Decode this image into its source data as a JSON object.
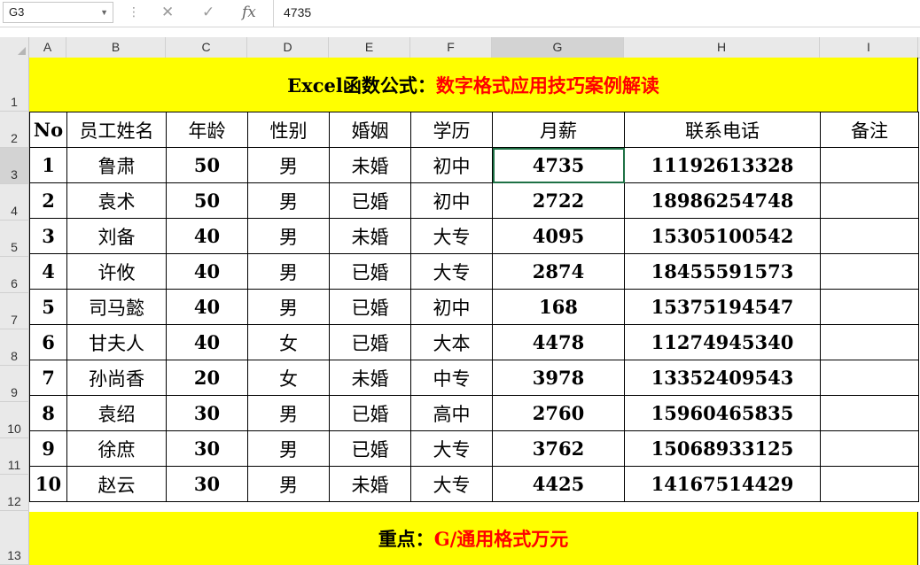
{
  "formula_bar": {
    "name_box": "G3",
    "dots": "⋮",
    "cancel_icon": "✕",
    "enter_icon": "✓",
    "fx_label": "fx",
    "content": "4735"
  },
  "columns": [
    "A",
    "B",
    "C",
    "D",
    "E",
    "F",
    "G",
    "H",
    "I"
  ],
  "rows": [
    "1",
    "2",
    "3",
    "4",
    "5",
    "6",
    "7",
    "8",
    "9",
    "10",
    "11",
    "12",
    "13"
  ],
  "title": {
    "prefix": "Excel函数公式：",
    "highlight": "数字格式应用技巧案例解读"
  },
  "table": {
    "headers": [
      "No",
      "员工姓名",
      "年龄",
      "性别",
      "婚姻",
      "学历",
      "月薪",
      "联系电话",
      "备注"
    ],
    "data": [
      [
        "1",
        "鲁肃",
        "50",
        "男",
        "未婚",
        "初中",
        "4735",
        "11192613328",
        ""
      ],
      [
        "2",
        "袁术",
        "50",
        "男",
        "已婚",
        "初中",
        "2722",
        "18986254748",
        ""
      ],
      [
        "3",
        "刘备",
        "40",
        "男",
        "未婚",
        "大专",
        "4095",
        "15305100542",
        ""
      ],
      [
        "4",
        "许攸",
        "40",
        "男",
        "已婚",
        "大专",
        "2874",
        "18455591573",
        ""
      ],
      [
        "5",
        "司马懿",
        "40",
        "男",
        "已婚",
        "初中",
        "168",
        "15375194547",
        ""
      ],
      [
        "6",
        "甘夫人",
        "40",
        "女",
        "已婚",
        "大本",
        "4478",
        "11274945340",
        ""
      ],
      [
        "7",
        "孙尚香",
        "20",
        "女",
        "未婚",
        "中专",
        "3978",
        "13352409543",
        ""
      ],
      [
        "8",
        "袁绍",
        "30",
        "男",
        "已婚",
        "高中",
        "2760",
        "15960465835",
        ""
      ],
      [
        "9",
        "徐庶",
        "30",
        "男",
        "已婚",
        "大专",
        "3762",
        "15068933125",
        ""
      ],
      [
        "10",
        "赵云",
        "30",
        "男",
        "未婚",
        "大专",
        "4425",
        "14167514429",
        ""
      ]
    ]
  },
  "footer": {
    "prefix": "重点：",
    "highlight": "G/通用格式万元"
  },
  "colors": {
    "banner_bg": "#ffff00",
    "accent_red": "#ff0000",
    "header_bg": "#e9e9e9",
    "selection": "#1e7145"
  }
}
